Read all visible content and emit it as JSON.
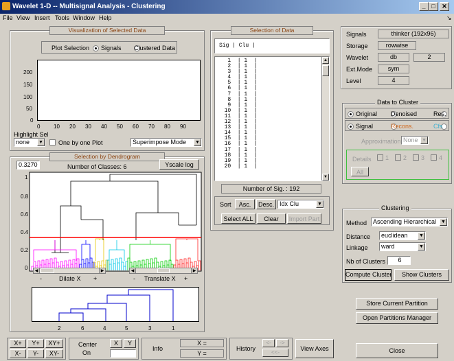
{
  "window": {
    "title": "Wavelet 1-D -- Multisignal Analysis - Clustering"
  },
  "menu": [
    "File",
    "View",
    "Insert",
    "Tools",
    "Window",
    "Help"
  ],
  "viz": {
    "title": "Visualization of Selected Data",
    "plot_selection_label": "Plot Selection",
    "opt_signals": "Signals",
    "opt_clustered": "Clustered Data",
    "yticks": [
      "200",
      "150",
      "100",
      "50",
      "0"
    ],
    "xticks": [
      "0",
      "10",
      "20",
      "30",
      "40",
      "50",
      "60",
      "70",
      "80",
      "90"
    ],
    "highlight_label": "Highlight Sel",
    "highlight_value": "none",
    "one_by_one": "One by one Plot",
    "mode_value": "Superimpose Mode"
  },
  "dendro": {
    "title": "Selection by Dendrogram",
    "threshold": "0.3270",
    "num_classes": "Number of Classes: 6",
    "yscale_btn": "Yscale log",
    "yticks": [
      "1",
      "0.8",
      "0.6",
      "0.4",
      "0.2",
      "0"
    ],
    "dilate_label": "Dilate X",
    "translate_label": "Translate X",
    "minus": "-",
    "plus": "+",
    "bottom_labels": [
      "2",
      "6",
      "4",
      "5",
      "3",
      "1"
    ]
  },
  "seldata": {
    "title": "Selection of Data",
    "header": "Sig | Clu |",
    "rows": [
      "   1  | 1  |",
      "   2  | 1  |",
      "   3  | 1  |",
      "   4  | 1  |",
      "   5  | 1  |",
      "   6  | 1  |",
      "   7  | 1  |",
      "   8  | 1  |",
      "   9  | 1  |",
      "  10  | 1  |",
      "  11  | 1  |",
      "  12  | 1  |",
      "  13  | 1  |",
      "  14  | 1  |",
      "  15  | 1  |",
      "  16  | 1  |",
      "  17  | 1  |",
      "  18  | 1  |",
      "  19  | 1  |",
      "  20  | 1  |"
    ],
    "num_sig": "Number of Sig. : 192",
    "sort_label": "Sort",
    "asc": "Asc.",
    "desc": "Desc.",
    "sort_key": "Idx Clu",
    "select_all": "Select ALL",
    "clear": "Clear",
    "import_part": "Import Part"
  },
  "info": {
    "signals_label": "Signals",
    "signals_value": "thinker (192x96)",
    "storage_label": "Storage",
    "storage_value": "rowwise",
    "wavelet_label": "Wavelet",
    "wavelet_family": "db",
    "wavelet_num": "2",
    "extmode_label": "Ext.Mode",
    "extmode_value": "sym",
    "level_label": "Level",
    "level_value": "4"
  },
  "cluster_data": {
    "title": "Data to Cluster",
    "original": "Original",
    "denoised": "Denoised",
    "res": "Res.",
    "signal": "Signal",
    "recons": "Recons.",
    "cfs": "Cfs",
    "approx_label": "Approximation",
    "approx_value": "None",
    "details_label": "Details",
    "d_nums": [
      "1",
      "2",
      "3",
      "4"
    ],
    "all_btn": "All"
  },
  "clustering": {
    "title": "Clustering",
    "method_label": "Method",
    "method_value": "Ascending Hierarchical",
    "distance_label": "Distance",
    "distance_value": "euclidean",
    "linkage_label": "Linkage",
    "linkage_value": "ward",
    "nb_label": "Nb of Clusters",
    "nb_value": "6",
    "compute_btn": "Compute Clusters",
    "show_btn": "Show Clusters"
  },
  "partitions": {
    "store_btn": "Store Current Partition",
    "open_btn": "Open Partitions Manager"
  },
  "toolbar": {
    "xp": "X+",
    "yp": "Y+",
    "xyp": "XY+",
    "xm": "X-",
    "ym": "Y-",
    "xym": "XY-",
    "center_label": "Center",
    "center_on": "On",
    "x_btn": "X",
    "y_btn": "Y",
    "info_label": "Info",
    "x_eq": "X =",
    "y_eq": "Y =",
    "history_label": "History",
    "hist_back": "<-",
    "hist_fwd": "->",
    "hist_reset": "<<-",
    "view_axes": "View Axes",
    "close": "Close"
  },
  "colors": {
    "threshold_line": "#ff0000",
    "dendro_top": "#000000"
  }
}
